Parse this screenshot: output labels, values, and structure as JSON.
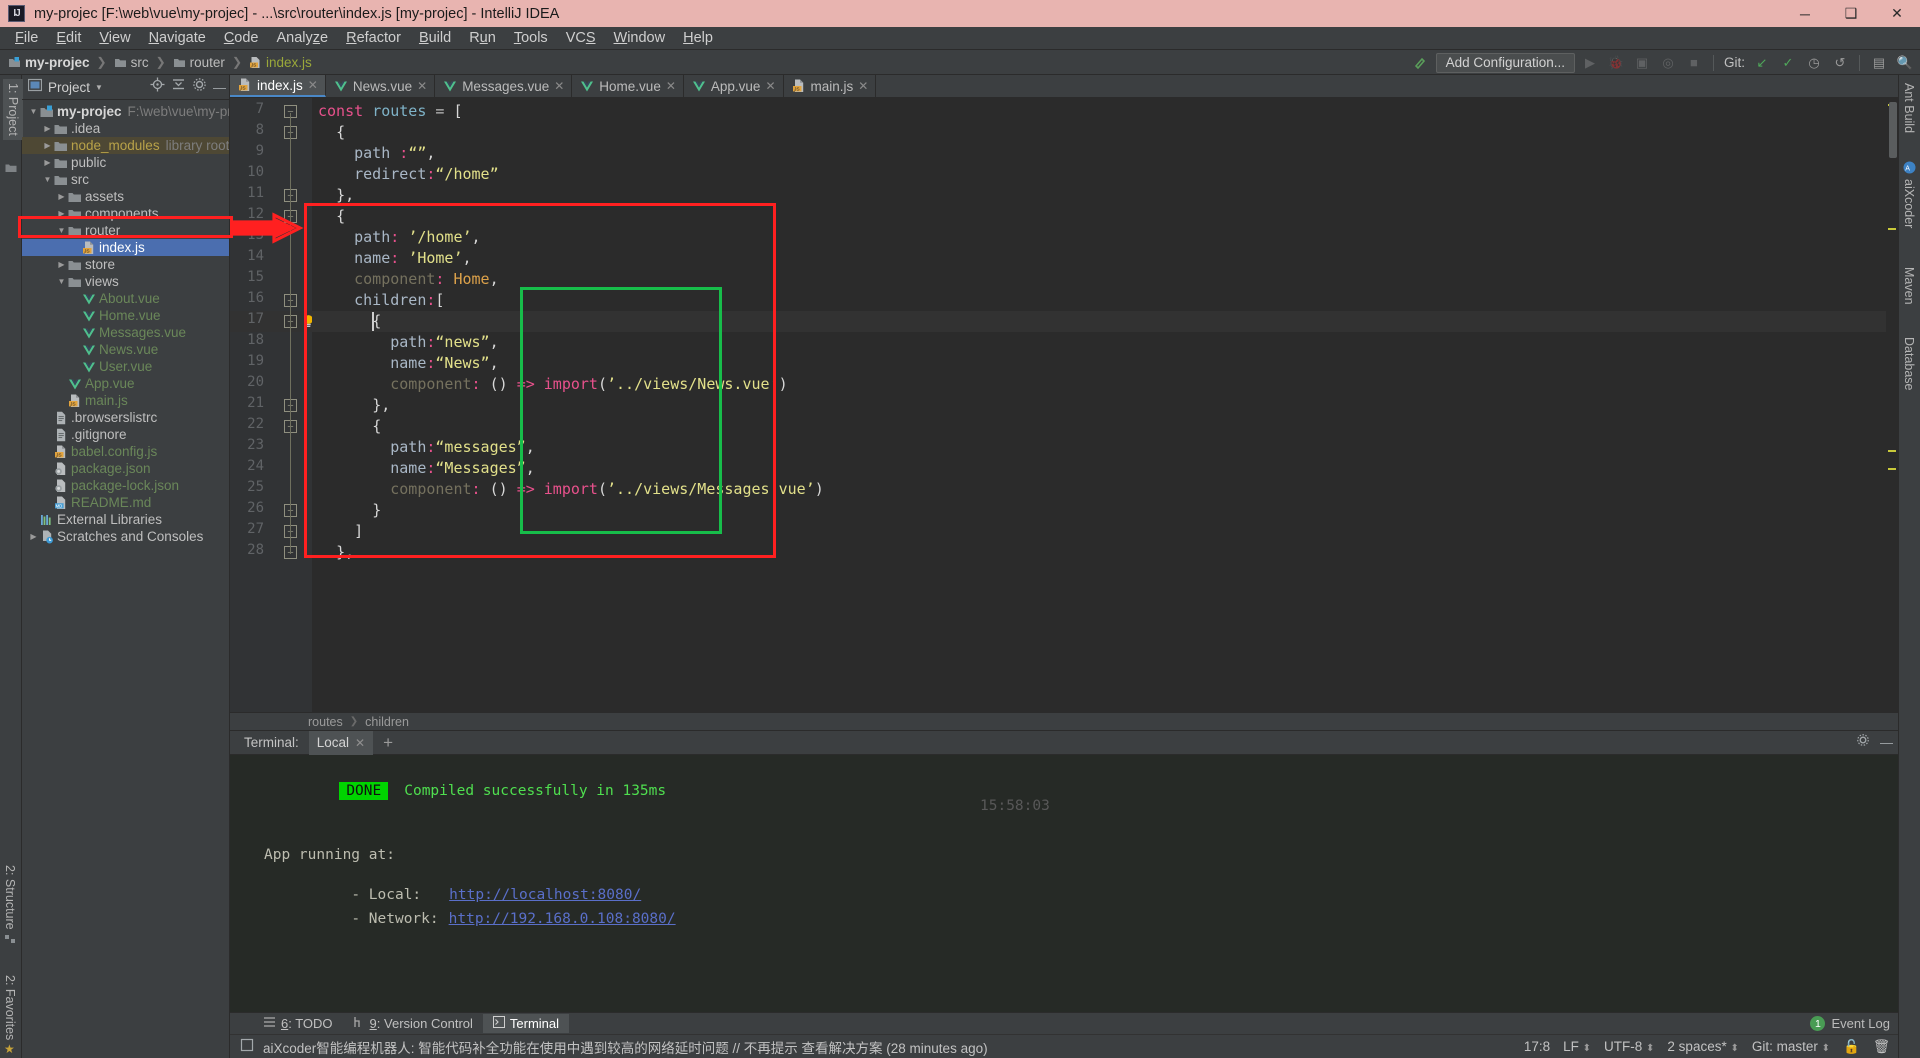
{
  "window": {
    "title": "my-projec [F:\\web\\vue\\my-projec] - ...\\src\\router\\index.js [my-projec] - IntelliJ IDEA",
    "logo": "IJ",
    "minimize": "─",
    "maximize": "❑",
    "close": "✕"
  },
  "menu": [
    "File",
    "Edit",
    "View",
    "Navigate",
    "Code",
    "Analyze",
    "Refactor",
    "Build",
    "Run",
    "Tools",
    "VCS",
    "Window",
    "Help"
  ],
  "navbar": {
    "crumbs": [
      "my-projec",
      "src",
      "router",
      "index.js"
    ],
    "add_configuration": "Add Configuration...",
    "git_label": "Git:"
  },
  "left_strip": {
    "project_tab": "1: Project",
    "structure_tab": "2: Structure",
    "favorites_tab": "2: Favorites"
  },
  "right_strip": {
    "ant_build": "Ant Build",
    "aixcoder": "aiXcoder",
    "maven": "Maven",
    "database": "Database"
  },
  "project_panel": {
    "title": "Project",
    "tree": [
      {
        "depth": 0,
        "arrow": "down",
        "icon": "module-icon",
        "label": "my-projec",
        "bold": true,
        "sub": "F:\\web\\vue\\my-projec",
        "color": "bold"
      },
      {
        "depth": 1,
        "arrow": "right",
        "icon": "folder-icon",
        "label": ".idea",
        "color": "plain"
      },
      {
        "depth": 1,
        "arrow": "right",
        "icon": "folder-icon",
        "label": "node_modules",
        "sub": "library root",
        "color": "yellow",
        "highlight": true
      },
      {
        "depth": 1,
        "arrow": "right",
        "icon": "folder-icon",
        "label": "public",
        "color": "plain"
      },
      {
        "depth": 1,
        "arrow": "down",
        "icon": "folder-src-icon",
        "label": "src",
        "color": "plain"
      },
      {
        "depth": 2,
        "arrow": "right",
        "icon": "folder-icon",
        "label": "assets",
        "color": "plain"
      },
      {
        "depth": 2,
        "arrow": "right",
        "icon": "folder-icon",
        "label": "components",
        "color": "plain"
      },
      {
        "depth": 2,
        "arrow": "down",
        "icon": "folder-icon",
        "label": "router",
        "color": "plain"
      },
      {
        "depth": 3,
        "arrow": "none",
        "icon": "js-file-icon",
        "label": "index.js",
        "color": "plain",
        "selected": true
      },
      {
        "depth": 2,
        "arrow": "right",
        "icon": "folder-icon",
        "label": "store",
        "color": "plain"
      },
      {
        "depth": 2,
        "arrow": "down",
        "icon": "folder-icon",
        "label": "views",
        "color": "plain"
      },
      {
        "depth": 3,
        "arrow": "none",
        "icon": "vue-file-icon",
        "label": "About.vue",
        "color": "green"
      },
      {
        "depth": 3,
        "arrow": "none",
        "icon": "vue-file-icon",
        "label": "Home.vue",
        "color": "green"
      },
      {
        "depth": 3,
        "arrow": "none",
        "icon": "vue-file-icon",
        "label": "Messages.vue",
        "color": "green"
      },
      {
        "depth": 3,
        "arrow": "none",
        "icon": "vue-file-icon",
        "label": "News.vue",
        "color": "green"
      },
      {
        "depth": 3,
        "arrow": "none",
        "icon": "vue-file-icon",
        "label": "User.vue",
        "color": "green"
      },
      {
        "depth": 2,
        "arrow": "none",
        "icon": "vue-file-icon",
        "label": "App.vue",
        "color": "green"
      },
      {
        "depth": 2,
        "arrow": "none",
        "icon": "js-file-icon",
        "label": "main.js",
        "color": "green"
      },
      {
        "depth": 1,
        "arrow": "none",
        "icon": "text-file-icon",
        "label": ".browserslistrc",
        "color": "plain"
      },
      {
        "depth": 1,
        "arrow": "none",
        "icon": "text-file-icon",
        "label": ".gitignore",
        "color": "plain"
      },
      {
        "depth": 1,
        "arrow": "none",
        "icon": "js-file-icon",
        "label": "babel.config.js",
        "color": "green"
      },
      {
        "depth": 1,
        "arrow": "none",
        "icon": "json-file-icon",
        "label": "package.json",
        "color": "green"
      },
      {
        "depth": 1,
        "arrow": "none",
        "icon": "json-file-icon",
        "label": "package-lock.json",
        "color": "green"
      },
      {
        "depth": 1,
        "arrow": "none",
        "icon": "md-file-icon",
        "label": "README.md",
        "color": "green"
      },
      {
        "depth": 0,
        "arrow": "none",
        "icon": "library-icon",
        "label": "External Libraries",
        "color": "plain"
      },
      {
        "depth": 0,
        "arrow": "right",
        "icon": "scratch-icon",
        "label": "Scratches and Consoles",
        "color": "plain"
      }
    ]
  },
  "editor": {
    "tabs": [
      {
        "label": "index.js",
        "icon": "js-file-icon",
        "active": true
      },
      {
        "label": "News.vue",
        "icon": "vue-file-icon",
        "active": false
      },
      {
        "label": "Messages.vue",
        "icon": "vue-file-icon",
        "active": false
      },
      {
        "label": "Home.vue",
        "icon": "vue-file-icon",
        "active": false
      },
      {
        "label": "App.vue",
        "icon": "vue-file-icon",
        "active": false
      },
      {
        "label": "main.js",
        "icon": "js-file-icon",
        "active": false
      }
    ],
    "first_line_number": 7,
    "lines": [
      {
        "n": 7,
        "text": "const routes = ["
      },
      {
        "n": 8,
        "text": "  {"
      },
      {
        "n": 9,
        "text": "    path :“”,"
      },
      {
        "n": 10,
        "text": "    redirect:“/home”"
      },
      {
        "n": 11,
        "text": "  },"
      },
      {
        "n": 12,
        "text": "  {"
      },
      {
        "n": 13,
        "text": "    path: ’/home’,"
      },
      {
        "n": 14,
        "text": "    name: ’Home’,"
      },
      {
        "n": 15,
        "text": "    component: Home,"
      },
      {
        "n": 16,
        "text": "    children:["
      },
      {
        "n": 17,
        "text": "      {"
      },
      {
        "n": 18,
        "text": "        path:“news”,"
      },
      {
        "n": 19,
        "text": "        name:“News”,"
      },
      {
        "n": 20,
        "text": "        component: () => import(’../views/News.vue’)"
      },
      {
        "n": 21,
        "text": "      },"
      },
      {
        "n": 22,
        "text": "      {"
      },
      {
        "n": 23,
        "text": "        path:“messages”,"
      },
      {
        "n": 24,
        "text": "        name:“Messages”,"
      },
      {
        "n": 25,
        "text": "        component: () => import(’../views/Messages.vue’)"
      },
      {
        "n": 26,
        "text": "      }"
      },
      {
        "n": 27,
        "text": "    ]"
      },
      {
        "n": 28,
        "text": "  },"
      }
    ],
    "current_line": 17,
    "breadcrumbs": [
      "routes",
      "children"
    ],
    "annotations": {
      "red_box": "highlights the /home route object",
      "green_box": "highlights the children array",
      "red_arrow": "points from index.js file to the route code"
    }
  },
  "terminal": {
    "label": "Terminal:",
    "tab": "Local",
    "add_tab": "+",
    "output": {
      "badge": "DONE",
      "compiled": "Compiled successfully in 135ms",
      "timestamp": "15:58:03",
      "app_running": "App running at:",
      "local_label": "- Local:",
      "local_url": "http://localhost:8080/",
      "network_label": "- Network:",
      "network_url": "http://192.168.0.108:8080/"
    }
  },
  "bottom_tabs": [
    {
      "num": "6",
      "label": ": TODO",
      "icon": "todo-icon",
      "active": false
    },
    {
      "num": "9",
      "label": ": Version Control",
      "icon": "vcs-icon",
      "active": false
    },
    {
      "num": "",
      "label": "Terminal",
      "icon": "terminal-icon",
      "active": true
    }
  ],
  "event_log": {
    "count": "1",
    "label": "Event Log"
  },
  "statusbar": {
    "message": "aiXcoder智能编程机器人: 智能代码补全功能在使用中遇到较高的网络延时问题 // 不再提示 查看解决方案 (28 minutes ago)",
    "caret_position": "17:8",
    "line_separator": "LF",
    "encoding": "UTF-8",
    "indent": "2 spaces*",
    "branch": "Git: master"
  },
  "colors": {
    "title_bar": "#e8b4b0",
    "annotation_red": "#ff2020",
    "annotation_green": "#17bd4a",
    "selection_blue": "#4b6eaf",
    "terminal_green": "#4fdf4f",
    "vue_green": "#4fc08d"
  }
}
